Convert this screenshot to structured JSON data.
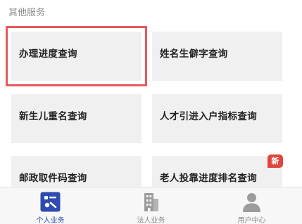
{
  "section": {
    "title": "其他服务"
  },
  "services": [
    {
      "label": "办理进度查询"
    },
    {
      "label": "姓名生僻字查询"
    },
    {
      "label": "新生儿重名查询"
    },
    {
      "label": "人才引进入户指标查询"
    },
    {
      "label": "邮政取件码查询"
    },
    {
      "label": "老人投靠进度排名查询",
      "badge": "新"
    }
  ],
  "tabs": [
    {
      "label": "个人业务",
      "icon": "personal-card-icon",
      "active": true
    },
    {
      "label": "法人业务",
      "icon": "building-icon",
      "active": false
    },
    {
      "label": "用户中心",
      "icon": "user-icon",
      "active": false
    }
  ],
  "colors": {
    "card_bg": "#f0f0f0",
    "highlight": "#e4595c",
    "badge": "#e0443d",
    "active_tab": "#2e4bb1",
    "inactive_tab": "#999999"
  }
}
